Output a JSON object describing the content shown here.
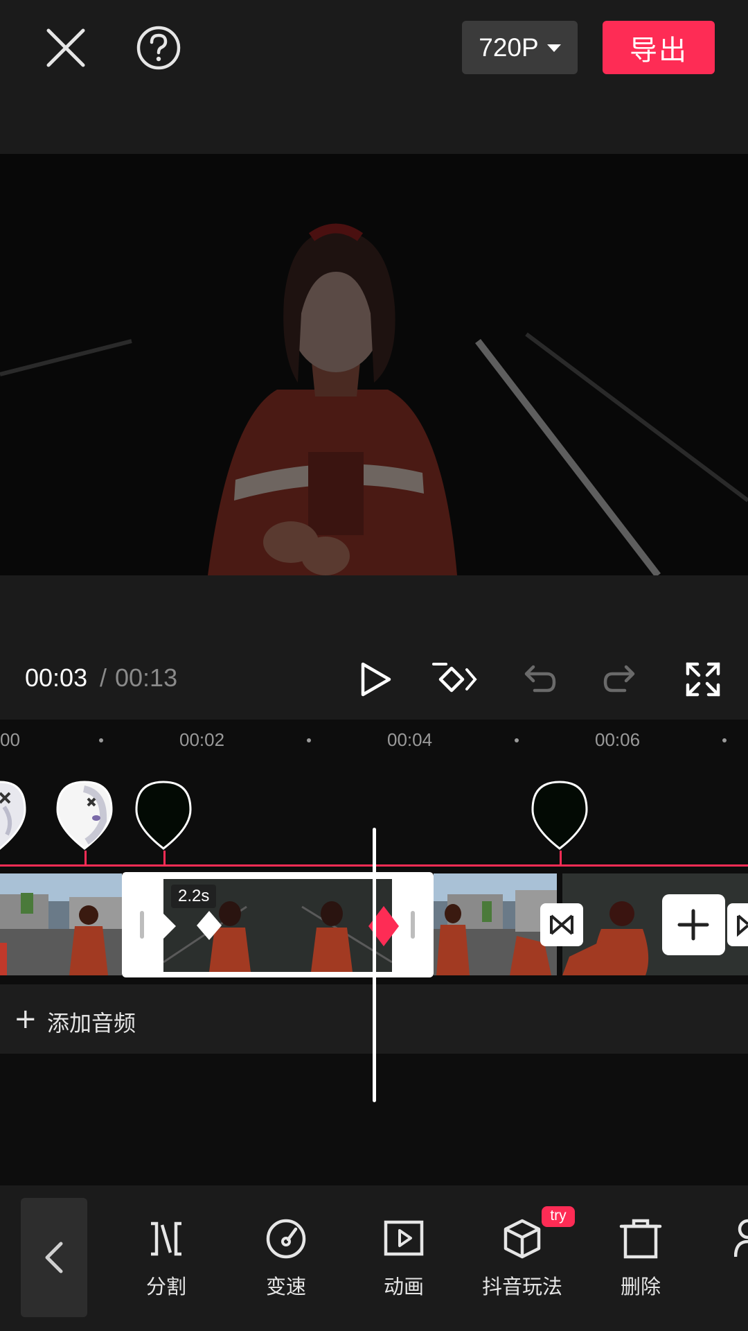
{
  "header": {
    "resolution": "720P",
    "export_label": "导出"
  },
  "playback": {
    "current_time": "00:03",
    "separator": "/",
    "total_time": "00:13"
  },
  "ruler": {
    "ticks": [
      "00",
      "00:02",
      "00:04",
      "00:06"
    ]
  },
  "timeline": {
    "selected_clip_duration": "2.2s",
    "add_audio_label": "添加音频",
    "add_audio_icon": "+"
  },
  "toolbar": {
    "items": [
      {
        "label": "分割",
        "icon": "split-icon"
      },
      {
        "label": "变速",
        "icon": "speed-icon"
      },
      {
        "label": "动画",
        "icon": "animation-icon"
      },
      {
        "label": "抖音玩法",
        "icon": "cube-icon",
        "badge": "try"
      },
      {
        "label": "删除",
        "icon": "delete-icon"
      }
    ]
  },
  "colors": {
    "accent": "#fe2c55",
    "panel": "#1b1b1b",
    "background": "#0d0d0d"
  }
}
